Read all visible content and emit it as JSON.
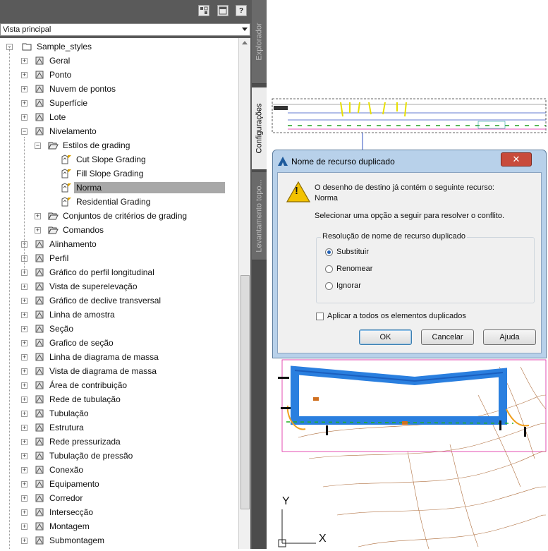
{
  "toolspace": {
    "view_select": "Vista principal",
    "help_label": "?",
    "tree": [
      {
        "label": "Sample_styles",
        "level": 0,
        "icon": "folder-icon",
        "exp": "-"
      },
      {
        "label": "Geral",
        "level": 1,
        "icon": "general-icon",
        "exp": "+"
      },
      {
        "label": "Ponto",
        "level": 1,
        "icon": "point-icon",
        "exp": "+"
      },
      {
        "label": "Nuvem de pontos",
        "level": 1,
        "icon": "point-cloud-icon",
        "exp": "+"
      },
      {
        "label": "Superfície",
        "level": 1,
        "icon": "surface-icon",
        "exp": "+"
      },
      {
        "label": "Lote",
        "level": 1,
        "icon": "parcel-icon",
        "exp": "+"
      },
      {
        "label": "Nivelamento",
        "level": 1,
        "icon": "grading-icon",
        "exp": "-"
      },
      {
        "label": "Estilos de grading",
        "level": 2,
        "icon": "folder-open-icon",
        "exp": "-"
      },
      {
        "label": "Cut Slope Grading",
        "level": 3,
        "icon": "grading-style-icon",
        "exp": ""
      },
      {
        "label": "Fill Slope Grading",
        "level": 3,
        "icon": "grading-style-icon",
        "exp": ""
      },
      {
        "label": "Norma",
        "level": 3,
        "icon": "grading-style-icon",
        "exp": "",
        "selected": true
      },
      {
        "label": "Residential Grading",
        "level": 3,
        "icon": "grading-style-icon",
        "exp": ""
      },
      {
        "label": "Conjuntos de critérios de grading",
        "level": 2,
        "icon": "folder-open-icon",
        "exp": "+"
      },
      {
        "label": "Comandos",
        "level": 2,
        "icon": "folder-open-icon",
        "exp": "+"
      },
      {
        "label": "Alinhamento",
        "level": 1,
        "icon": "alignment-icon",
        "exp": "+"
      },
      {
        "label": "Perfil",
        "level": 1,
        "icon": "profile-icon",
        "exp": "+"
      },
      {
        "label": "Gráfico do perfil longitudinal",
        "level": 1,
        "icon": "profile-view-icon",
        "exp": "+"
      },
      {
        "label": "Vista de superelevação",
        "level": 1,
        "icon": "superelevation-icon",
        "exp": "+"
      },
      {
        "label": "Gráfico de declive transversal",
        "level": 1,
        "icon": "cant-view-icon",
        "exp": "+"
      },
      {
        "label": "Linha de amostra",
        "level": 1,
        "icon": "sample-line-icon",
        "exp": "+"
      },
      {
        "label": "Seção",
        "level": 1,
        "icon": "section-icon",
        "exp": "+"
      },
      {
        "label": "Grafico de seção",
        "level": 1,
        "icon": "section-view-icon",
        "exp": "+"
      },
      {
        "label": "Linha de diagrama de massa",
        "level": 1,
        "icon": "mass-haul-line-icon",
        "exp": "+"
      },
      {
        "label": "Vista de diagrama de massa",
        "level": 1,
        "icon": "mass-haul-view-icon",
        "exp": "+"
      },
      {
        "label": "Área de contribuição",
        "level": 1,
        "icon": "catchment-icon",
        "exp": "+"
      },
      {
        "label": "Rede de tubulação",
        "level": 1,
        "icon": "pipe-network-icon",
        "exp": "+"
      },
      {
        "label": "Tubulação",
        "level": 1,
        "icon": "pipe-icon",
        "exp": "+"
      },
      {
        "label": "Estrutura",
        "level": 1,
        "icon": "structure-icon",
        "exp": "+"
      },
      {
        "label": "Rede pressurizada",
        "level": 1,
        "icon": "pressure-network-icon",
        "exp": "+"
      },
      {
        "label": "Tubulação de pressão",
        "level": 1,
        "icon": "pressure-pipe-icon",
        "exp": "+"
      },
      {
        "label": "Conexão",
        "level": 1,
        "icon": "fitting-icon",
        "exp": "+"
      },
      {
        "label": "Equipamento",
        "level": 1,
        "icon": "appurtenance-icon",
        "exp": "+"
      },
      {
        "label": "Corredor",
        "level": 1,
        "icon": "corridor-icon",
        "exp": "+"
      },
      {
        "label": "Intersecção",
        "level": 1,
        "icon": "intersection-icon",
        "exp": "+"
      },
      {
        "label": "Montagem",
        "level": 1,
        "icon": "assembly-icon",
        "exp": "+"
      },
      {
        "label": "Submontagem",
        "level": 1,
        "icon": "subassembly-icon",
        "exp": "+"
      }
    ],
    "tabs": [
      "Explorador",
      "Configurações",
      "Levantamento topo..."
    ]
  },
  "drawing": {
    "axis_y": "Y",
    "axis_x": "X"
  },
  "dialog": {
    "title": "Nome de recurso duplicado",
    "close_label": "✕",
    "message_line1": "O desenho de destino já contém o seguinte recurso:",
    "message_line2": "Norma",
    "instruction": "Selecionar uma opção a seguir para resolver o conflito.",
    "group_title": "Resolução de nome de recurso duplicado",
    "options": [
      {
        "label": "Substituir",
        "checked": true
      },
      {
        "label": "Renomear",
        "checked": false
      },
      {
        "label": "Ignorar",
        "checked": false
      }
    ],
    "apply_all": "Aplicar a todos os elementos duplicados",
    "buttons": {
      "ok": "OK",
      "cancel": "Cancelar",
      "help": "Ajuda"
    },
    "warning_glyph": "!"
  }
}
